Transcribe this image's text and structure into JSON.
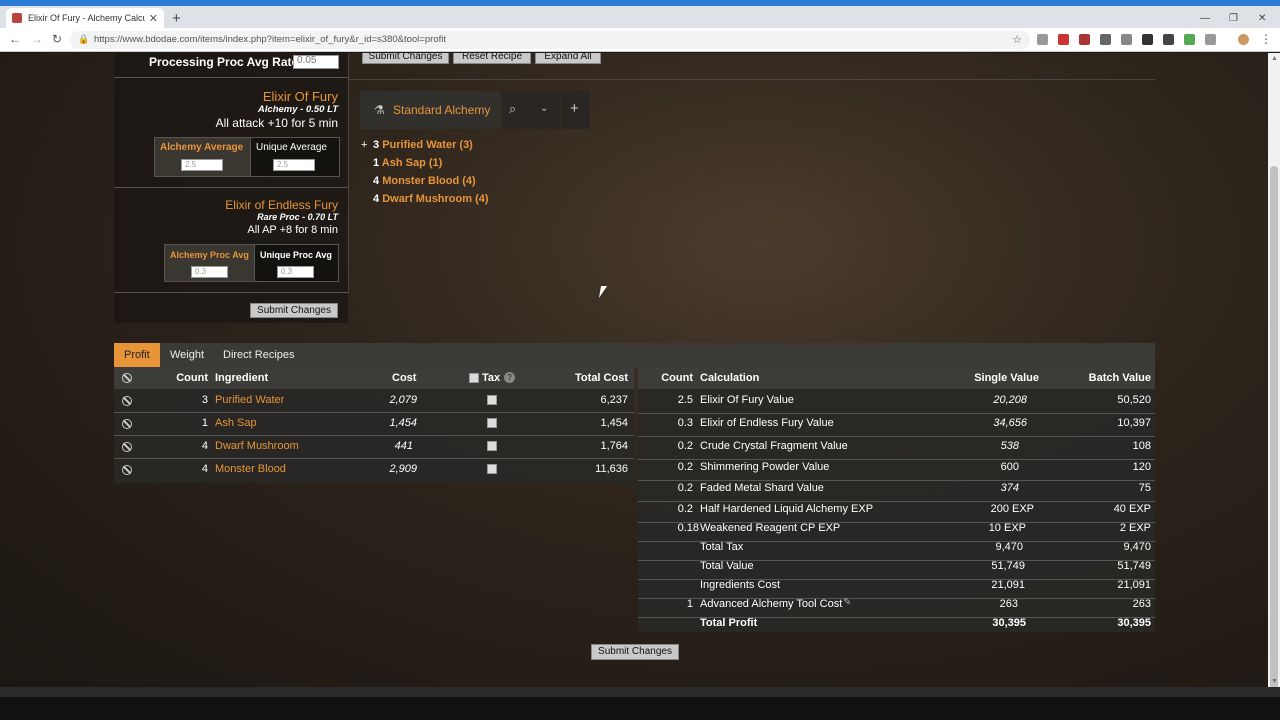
{
  "browser": {
    "tab_title": "Elixir Of Fury - Alchemy Calculat",
    "url": "https://www.bdodae.com/items/index.php?item=elixir_of_fury&r_id=s380&tool=profit"
  },
  "top_buttons": {
    "submit": "Submit Changes",
    "reset": "Reset Recipe",
    "expand": "Expand All"
  },
  "left": {
    "proc_rate_label": "Processing Proc Avg Rate:",
    "proc_rate_value": "0.05",
    "item1": {
      "name": "Elixir Of Fury",
      "sub": "Alchemy - 0.50 LT",
      "effect": "All attack +10 for 5 min",
      "avg_label": "Alchemy Average",
      "avg_value": "2.5",
      "unique_label": "Unique Average",
      "unique_value": "2.5"
    },
    "item2": {
      "name": "Elixir of Endless Fury",
      "sub": "Rare Proc - 0.70 LT",
      "effect": "All AP +8 for 8 min",
      "avg_label": "Alchemy Proc Avg",
      "avg_value": "0.3",
      "unique_label": "Unique Proc Avg",
      "unique_value": "0.3"
    },
    "submit": "Submit Changes"
  },
  "recipe": {
    "tool": "Standard Alchemy",
    "ingredients": [
      {
        "count": "3",
        "name": "Purified Water (3)"
      },
      {
        "count": "1",
        "name": "Ash Sap (1)"
      },
      {
        "count": "4",
        "name": "Monster Blood (4)"
      },
      {
        "count": "4",
        "name": "Dwarf Mushroom (4)"
      }
    ]
  },
  "tabs": [
    "Profit",
    "Weight",
    "Direct Recipes"
  ],
  "cost_table": {
    "headers": {
      "count": "Count",
      "ingredient": "Ingredient",
      "cost": "Cost",
      "tax": "Tax",
      "total": "Total Cost"
    },
    "rows": [
      {
        "count": "3",
        "name": "Purified Water",
        "cost": "2,079",
        "total": "6,237"
      },
      {
        "count": "1",
        "name": "Ash Sap",
        "cost": "1,454",
        "total": "1,454"
      },
      {
        "count": "4",
        "name": "Dwarf Mushroom",
        "cost": "441",
        "total": "1,764"
      },
      {
        "count": "4",
        "name": "Monster Blood",
        "cost": "2,909",
        "total": "11,636"
      }
    ]
  },
  "calc_table": {
    "headers": {
      "count": "Count",
      "calc": "Calculation",
      "single": "Single Value",
      "batch": "Batch Value"
    },
    "rows": [
      {
        "count": "2.5",
        "calc": "Elixir Of Fury Value",
        "single": "20,208",
        "batch": "50,520"
      },
      {
        "count": "0.3",
        "calc": "Elixir of Endless Fury Value",
        "single": "34,656",
        "batch": "10,397"
      },
      {
        "count": "0.2",
        "calc": "Crude Crystal Fragment Value",
        "single": "538",
        "batch": "108"
      },
      {
        "count": "0.2",
        "calc": "Shimmering Powder Value",
        "single": "600",
        "batch": "120"
      },
      {
        "count": "0.2",
        "calc": "Faded Metal Shard Value",
        "single": "374",
        "batch": "75"
      },
      {
        "count": "0.2",
        "calc": "Half Hardened Liquid Alchemy EXP",
        "single": "200 EXP",
        "batch": "40 EXP"
      },
      {
        "count": "0.18",
        "calc": "Weakened Reagent CP EXP",
        "single": "10 EXP",
        "batch": "2 EXP"
      },
      {
        "count": "",
        "calc": "Total Tax",
        "single": "9,470",
        "batch": "9,470"
      },
      {
        "count": "",
        "calc": "Total Value",
        "single": "51,749",
        "batch": "51,749"
      },
      {
        "count": "",
        "calc": "Ingredients Cost",
        "single": "21,091",
        "batch": "21,091"
      },
      {
        "count": "1",
        "calc": "Advanced Alchemy Tool Cost",
        "single": "263",
        "batch": "263"
      },
      {
        "count": "",
        "calc": "Total Profit",
        "single": "30,395",
        "batch": "30,395"
      }
    ]
  },
  "bottom_submit": "Submit Changes"
}
